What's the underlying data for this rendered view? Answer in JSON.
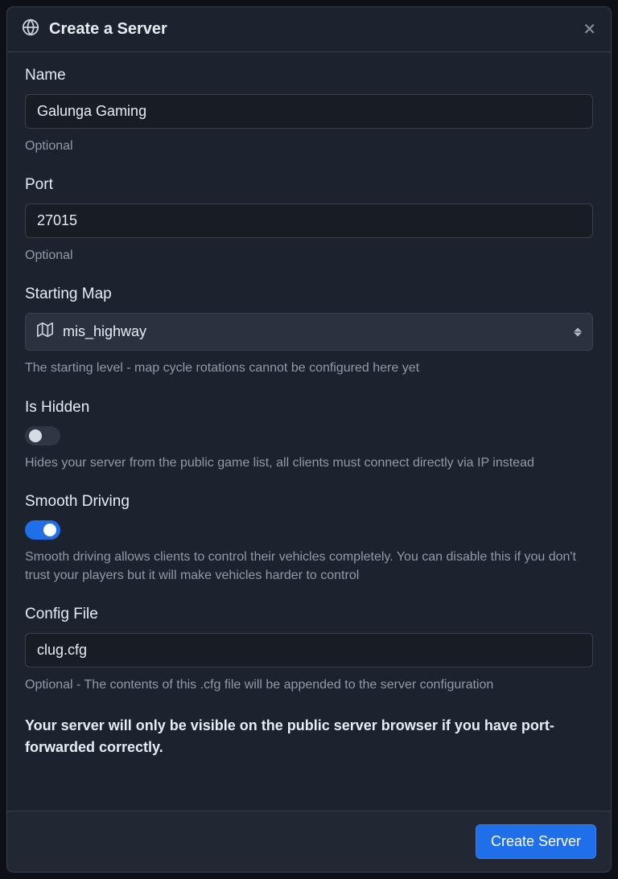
{
  "header": {
    "title": "Create a Server"
  },
  "fields": {
    "name": {
      "label": "Name",
      "value": "Galunga Gaming",
      "hint": "Optional"
    },
    "port": {
      "label": "Port",
      "value": "27015",
      "hint": "Optional"
    },
    "starting_map": {
      "label": "Starting Map",
      "value": "mis_highway",
      "hint": "The starting level - map cycle rotations cannot be configured here yet"
    },
    "is_hidden": {
      "label": "Is Hidden",
      "value": false,
      "hint": "Hides your server from the public game list, all clients must connect directly via IP instead"
    },
    "smooth_driving": {
      "label": "Smooth Driving",
      "value": true,
      "hint": "Smooth driving allows clients to control their vehicles completely. You can disable this if you don't trust your players but it will make vehicles harder to control"
    },
    "config_file": {
      "label": "Config File",
      "value": "clug.cfg",
      "hint": "Optional - The contents of this .cfg file will be appended to the server configuration"
    }
  },
  "notice": "Your server will only be visible on the public server browser if you have port-forwarded correctly.",
  "footer": {
    "submit_label": "Create Server"
  }
}
